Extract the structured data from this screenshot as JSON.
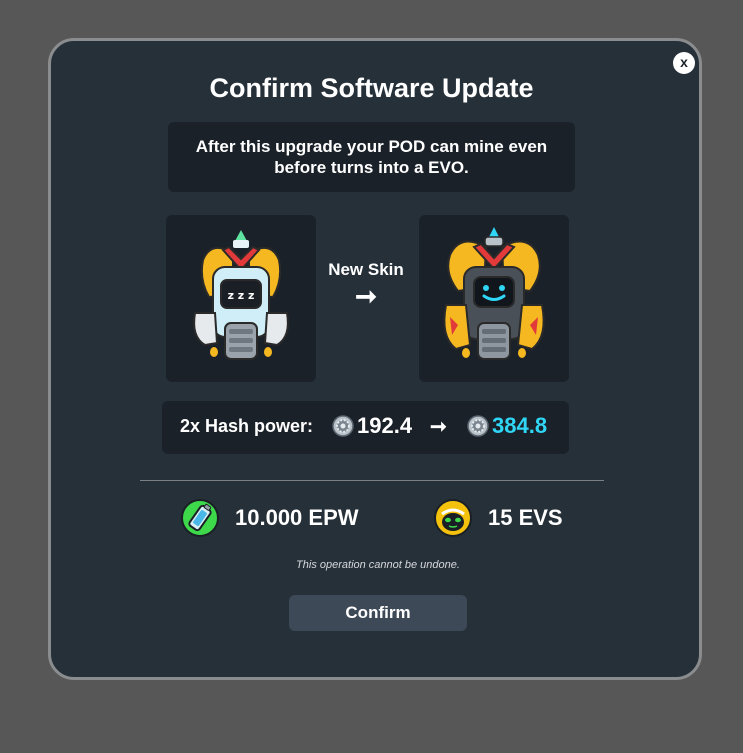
{
  "dialog": {
    "close_label": "x",
    "title": "Confirm Software Update",
    "info_text": "After this upgrade your POD can mine even before turns into a EVO."
  },
  "skin": {
    "label": "New Skin",
    "arrow": "➞",
    "from_icon": "pod-robot-white-icon",
    "to_icon": "evo-robot-dark-icon"
  },
  "hash": {
    "label": "2x Hash power:",
    "from_value": "192.4",
    "arrow": "➞",
    "to_value": "384.8",
    "icon": "gear-coin-icon",
    "to_color": "#2fd6f5"
  },
  "costs": [
    {
      "amount": "10.000 EPW",
      "icon": "epw-battery-icon",
      "color": "#3dd94a"
    },
    {
      "amount": "15 EVS",
      "icon": "evs-alien-icon",
      "color": "#f4c20d"
    }
  ],
  "note": "This operation cannot be undone.",
  "confirm_label": "Confirm"
}
